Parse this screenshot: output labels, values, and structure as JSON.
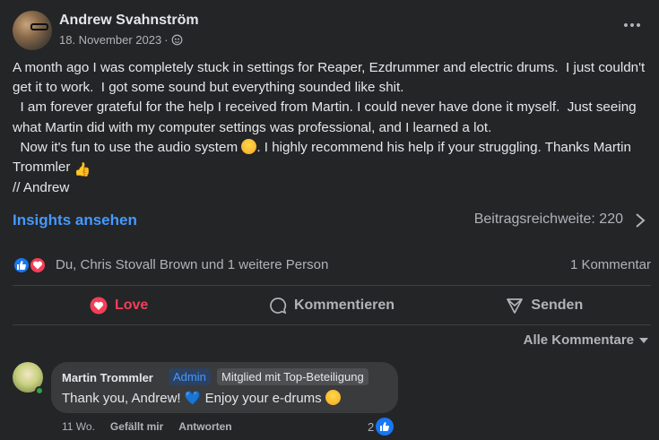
{
  "post": {
    "author": "Andrew Svahnström",
    "date": "18. November 2023",
    "separator": "·",
    "audience_icon": "public-icon",
    "more_icon": "more-options-icon",
    "lines": [
      "A month ago I was completely stuck in settings for Reaper, Ezdrummer and electric drums.  I just couldn't get it to work.  I got some sound but everything sounded like shit.",
      "  I am forever grateful for the help I received from Martin. I could never have done it myself.  Just seeing what Martin did with my computer settings was professional, and I learned a lot.",
      "  Now it's fun to use the audio system",
      ". I highly recommend his help if your struggling. Thanks Martin Trommler",
      "// Andrew"
    ]
  },
  "insights": {
    "link": "Insights ansehen",
    "reach": "Beitragsreichweite: 220"
  },
  "reactions": {
    "summary": "Du, Chris Stovall Brown und 1 weitere Person",
    "comments": "1 Kommentar"
  },
  "actions": {
    "love": "Love",
    "comment": "Kommentieren",
    "send": "Senden"
  },
  "comments_filter": "Alle Kommentare",
  "comment": {
    "name": "Martin Trommler",
    "admin": "Admin",
    "badge": "Mitglied mit Top-Beteiligung",
    "text_before": "Thank you, Andrew!",
    "text_mid": "Enjoy your e-drums",
    "time": "11 Wo.",
    "like": "Gefällt mir",
    "reply": "Antworten",
    "likes": "2"
  },
  "colors": {
    "background": "#242526",
    "link": "#4599ff",
    "love": "#f33e58",
    "like": "#1877f2",
    "online": "#31a24c"
  }
}
